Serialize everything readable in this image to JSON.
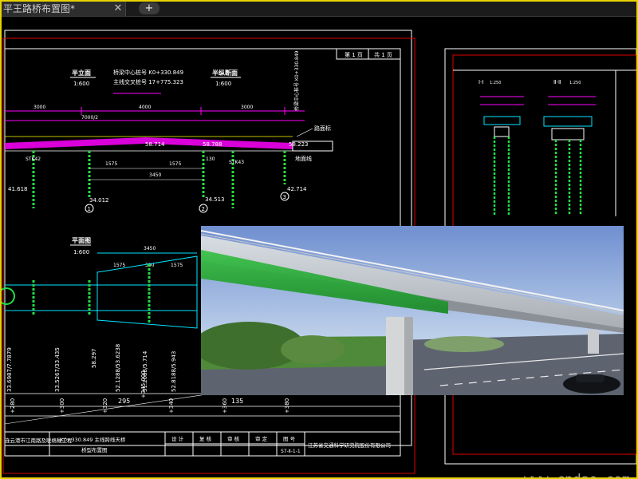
{
  "app": {
    "tab_title": "平王路桥布置图*",
    "tab_close_icon": "close-icon",
    "tab_add_icon": "plus-icon"
  },
  "colors": {
    "frame_border": "#e8d200",
    "magenta": "#ff00ff",
    "cyan": "#00e5ff",
    "green": "#22dd44",
    "yellow": "#ffff00",
    "white": "#ffffff",
    "red": "#e00000"
  },
  "drawing": {
    "sheet_labels": [
      "第 1 页",
      "共 1 页"
    ],
    "elevation_title": "半立面",
    "elevation_scale": "1:600",
    "center_station": "桥梁中心桩号 K0+330.849",
    "crossing_station": "主线交叉桩号 17+775.323",
    "half_section_title": "半纵断面",
    "half_section_scale": "1:600",
    "top_dims": [
      "3000",
      "4000",
      "3000"
    ],
    "span_dim": "7000/2",
    "elevations": [
      "58.714",
      "58.788",
      "58.223"
    ],
    "pier_dims": [
      "1575",
      "1575",
      "130",
      "3450"
    ],
    "pier_stations": [
      "STK42",
      "STK43"
    ],
    "bottom_elevations": [
      "34.012",
      "34.513",
      "42.714"
    ],
    "left_elevation": "41.618",
    "pier_numbers": [
      "1",
      "2",
      "3"
    ],
    "abutment_labels": [
      "路面标",
      "地面线"
    ],
    "plan_title": "平面图",
    "plan_scale": "1:600",
    "plan_dims": [
      "3450",
      "1575",
      "300",
      "1575"
    ],
    "vertical_table_values": [
      "33.6987/7.7879",
      "33.5267/33.435",
      "58.297",
      "52.1288/53.6238",
      "51.2088/5.714",
      "52.8188/5.943"
    ],
    "bottom_dims": [
      "295",
      "135"
    ],
    "bottom_stations": [
      "+280",
      "+300",
      "+320",
      "+345.000",
      "+340",
      "+360",
      "+380"
    ],
    "title_block": {
      "project": "连云港市江南路及联络线工程",
      "drawing_name_1": "LK0+330.849 主线跨线天桥",
      "drawing_name_2": "桥型布置图",
      "design": "设 计",
      "check": "复 核",
      "review": "审 核",
      "approve": "审 定",
      "drawing_no_label": "图 号",
      "drawing_no": "S7-Ⅱ-1-1",
      "company": "江苏省交通科学研究院股份有限公司"
    },
    "section_a_title": "Ⅰ-Ⅰ",
    "section_a_scale": "1:250",
    "section_b_title": "Ⅱ-Ⅱ",
    "section_b_scale": "1:250"
  },
  "render": {
    "subject": "bridge overpass rendering"
  },
  "watermark": "www.cndao.com"
}
